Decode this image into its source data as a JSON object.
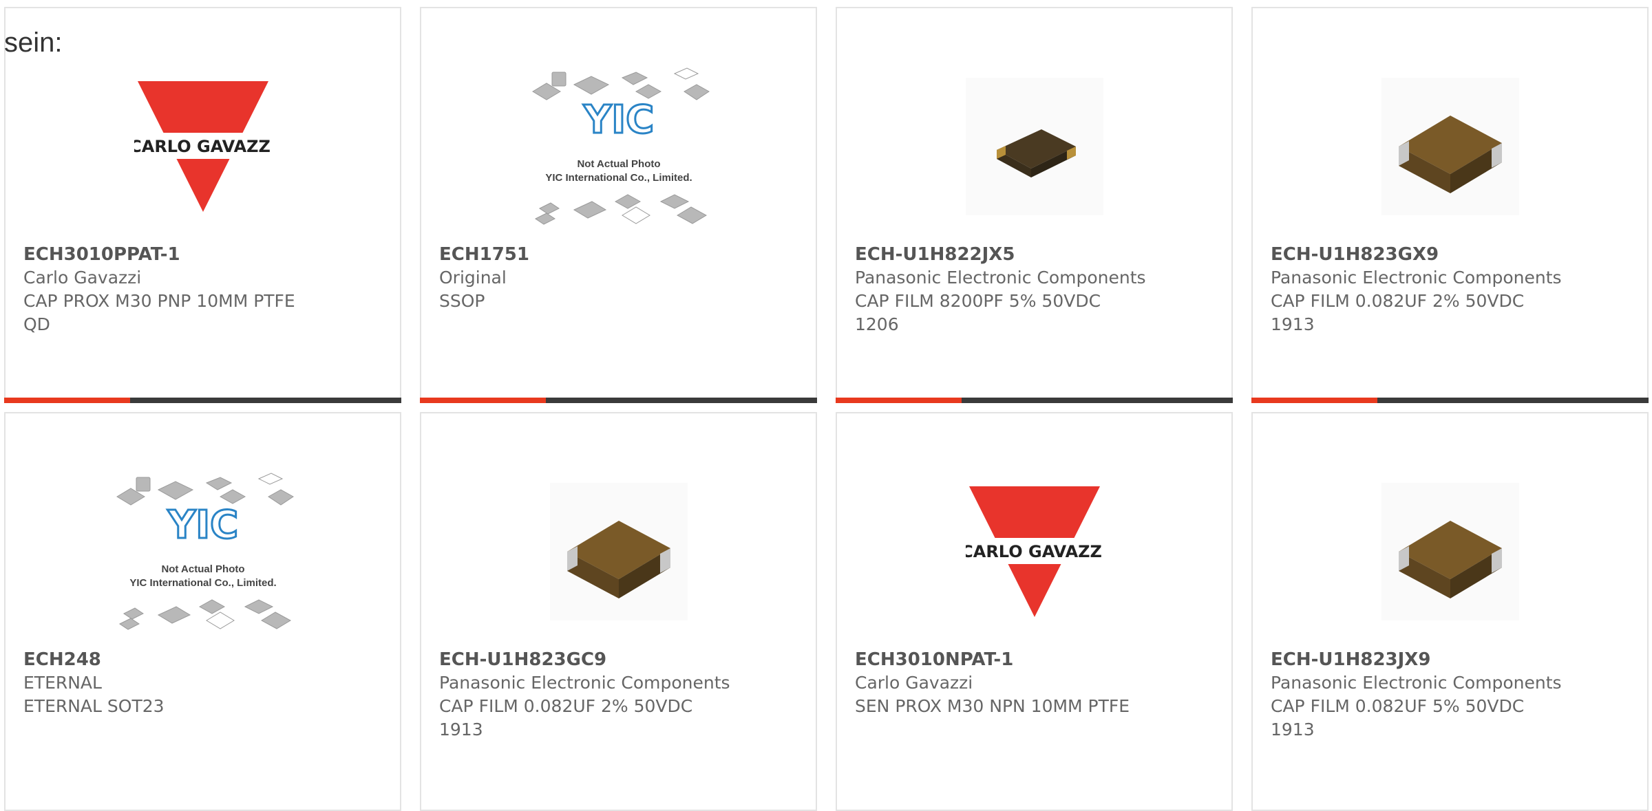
{
  "intro": {
    "text": "sein:"
  },
  "colors": {
    "accent": "#e8391e",
    "bar": "#3a3a3a",
    "carlo_red": "#e8342c",
    "yic_blue": "#2a84c6",
    "chip_body": "#7a5a28"
  },
  "products": [
    {
      "part": "ECH3010PPAT-1",
      "lines": [
        "Carlo Gavazzi",
        "CAP PROX M30 PNP 10MM PTFE",
        "QD"
      ],
      "image": "carlo-gavazzi-logo",
      "logo_text": "CARLO GAVAZZI"
    },
    {
      "part": "ECH1751",
      "lines": [
        "Original",
        "SSOP"
      ],
      "image": "yic-placeholder",
      "logo_text": "YIC",
      "caption1": "Not Actual Photo",
      "caption2": "YIC International Co., Limited."
    },
    {
      "part": "ECH-U1H822JX5",
      "lines": [
        "Panasonic Electronic Components",
        "CAP FILM 8200PF 5% 50VDC",
        "1206"
      ],
      "image": "chip-capacitor-small"
    },
    {
      "part": "ECH-U1H823GX9",
      "lines": [
        "Panasonic Electronic Components",
        "CAP FILM 0.082UF 2% 50VDC",
        "1913"
      ],
      "image": "chip-capacitor-large"
    },
    {
      "part": "ECH248",
      "lines": [
        "ETERNAL",
        "ETERNAL SOT23"
      ],
      "image": "yic-placeholder",
      "logo_text": "YIC",
      "caption1": "Not Actual Photo",
      "caption2": "YIC International Co., Limited."
    },
    {
      "part": "ECH-U1H823GC9",
      "lines": [
        "Panasonic Electronic Components",
        "CAP FILM 0.082UF 2% 50VDC",
        "1913"
      ],
      "image": "chip-capacitor-large"
    },
    {
      "part": "ECH3010NPAT-1",
      "lines": [
        "Carlo Gavazzi",
        "SEN PROX M30 NPN 10MM PTFE",
        ""
      ],
      "image": "carlo-gavazzi-logo",
      "logo_text": "CARLO GAVAZZI"
    },
    {
      "part": "ECH-U1H823JX9",
      "lines": [
        "Panasonic Electronic Components",
        "CAP FILM 0.082UF 5% 50VDC",
        "1913"
      ],
      "image": "chip-capacitor-large"
    }
  ]
}
